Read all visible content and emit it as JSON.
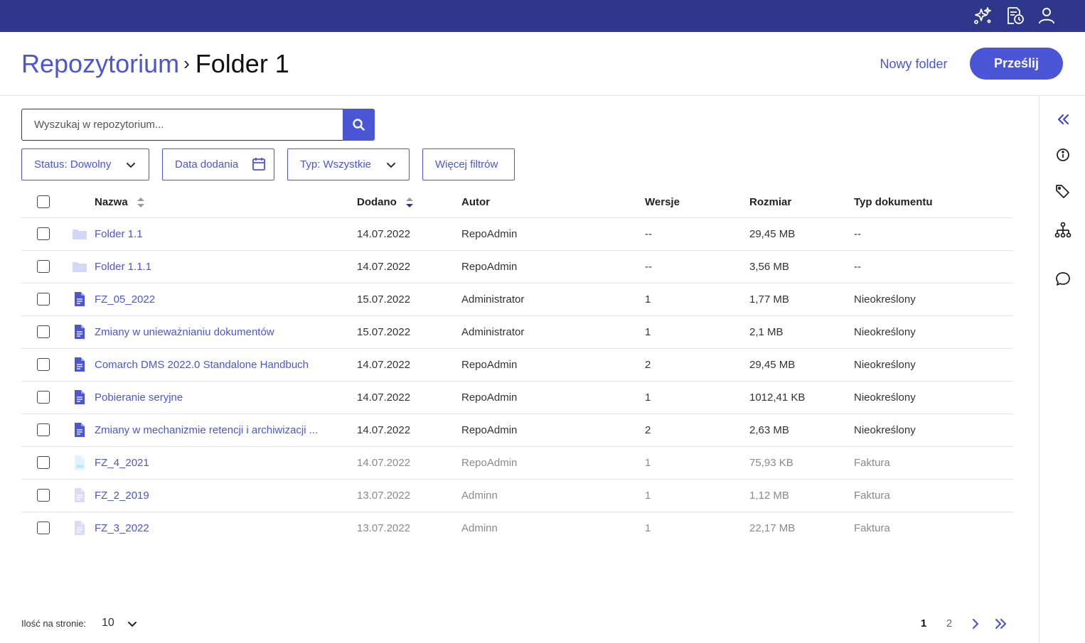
{
  "colors": {
    "topbar": "#2e3789",
    "accent": "#4a56d6",
    "muted_icon": "#c9cdf4"
  },
  "topbar": {
    "icons": [
      "sparkles-icon",
      "document-history-icon",
      "user-icon"
    ]
  },
  "header": {
    "breadcrumb_root": "Repozytorium",
    "breadcrumb_separator": "›",
    "breadcrumb_current": "Folder 1",
    "new_folder_label": "Nowy folder",
    "upload_label": "Prześlij"
  },
  "search": {
    "placeholder": "Wyszukaj w repozytorium..."
  },
  "filters": {
    "status": "Status: Dowolny",
    "date": "Data dodania",
    "type": "Typ: Wszystkie",
    "more": "Więcej filtrów"
  },
  "table": {
    "headers": {
      "name": "Nazwa",
      "added": "Dodano",
      "author": "Autor",
      "versions": "Wersje",
      "size": "Rozmiar",
      "doctype": "Typ dokumentu"
    },
    "rows": [
      {
        "icon": "folder-icon",
        "name": "Folder 1.1",
        "added": "14.07.2022",
        "author": "RepoAdmin",
        "versions": "--",
        "size": "29,45 MB",
        "doctype": "--"
      },
      {
        "icon": "folder-icon",
        "name": "Folder 1.1.1",
        "added": "14.07.2022",
        "author": "RepoAdmin",
        "versions": "--",
        "size": "3,56 MB",
        "doctype": "--"
      },
      {
        "icon": "document-icon",
        "name": "FZ_05_2022",
        "added": "15.07.2022",
        "author": "Administrator",
        "versions": "1",
        "size": "1,77 MB",
        "doctype": "Nieokreślony"
      },
      {
        "icon": "document-icon",
        "name": "Zmiany w unieważnianiu dokumentów",
        "added": "15.07.2022",
        "author": "Administrator",
        "versions": "1",
        "size": "2,1 MB",
        "doctype": "Nieokreślony"
      },
      {
        "icon": "document-icon",
        "name": "Comarch DMS 2022.0 Standalone Handbuch",
        "added": "14.07.2022",
        "author": "RepoAdmin",
        "versions": "2",
        "size": "29,45 MB",
        "doctype": "Nieokreślony"
      },
      {
        "icon": "document-icon",
        "name": "Pobieranie seryjne",
        "added": "14.07.2022",
        "author": "RepoAdmin",
        "versions": "1",
        "size": "1012,41 KB",
        "doctype": "Nieokreślony"
      },
      {
        "icon": "document-icon",
        "name": "Zmiany w mechanizmie retencji i archiwizacji ...",
        "added": "14.07.2022",
        "author": "RepoAdmin",
        "versions": "2",
        "size": "2,63 MB",
        "doctype": "Nieokreślony"
      },
      {
        "icon": "image-file-icon",
        "name": "FZ_4_2021",
        "added": "14.07.2022",
        "author": "RepoAdmin",
        "versions": "1",
        "size": "75,93 KB",
        "doctype": "Faktura"
      },
      {
        "icon": "document-icon",
        "name": "FZ_2_2019",
        "added": "13.07.2022",
        "author": "Adminn",
        "versions": "1",
        "size": "1,12 MB",
        "doctype": "Faktura"
      },
      {
        "icon": "document-icon",
        "name": "FZ_3_2022",
        "added": "13.07.2022",
        "author": "Adminn",
        "versions": "1",
        "size": "22,17 MB",
        "doctype": "Faktura"
      }
    ]
  },
  "pagination": {
    "per_page_label": "Ilość na stronie:",
    "per_page_value": "10",
    "pages": [
      "1",
      "2"
    ],
    "current_page": "1"
  },
  "sidebar": {
    "icons": [
      "collapse-double-chevron-icon",
      "info-icon",
      "tag-icon",
      "hierarchy-icon",
      "comment-icon"
    ]
  }
}
